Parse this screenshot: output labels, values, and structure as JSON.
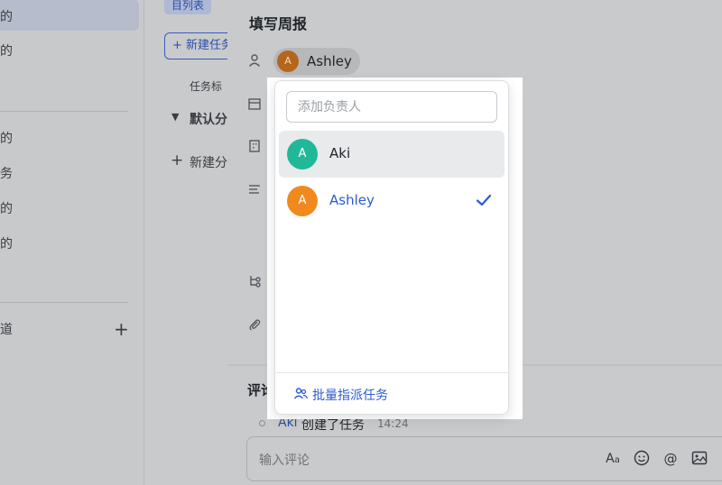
{
  "sidebar": {
    "items": [
      "的",
      "的",
      "的",
      "务",
      "的",
      "的",
      "道"
    ],
    "add_icon": "plus-icon"
  },
  "list_view": {
    "tab_label": "目列表",
    "new_task_label": "+ 新建任务",
    "task_header": "任务标",
    "default_group": "默认分",
    "new_group": "新建分"
  },
  "task_detail": {
    "title": "填写周报",
    "assignee": {
      "initial": "A",
      "name": "Ashley"
    },
    "comment_label": "评论",
    "activity": {
      "user": "Aki",
      "action": "创建了任务",
      "time": "14:24"
    },
    "comment_placeholder": "输入评论",
    "toolbar_icons": [
      "font-icon",
      "emoji-icon",
      "mention-icon",
      "image-icon"
    ]
  },
  "assignee_popup": {
    "search_placeholder": "添加负责人",
    "options": [
      {
        "initial": "A",
        "name": "Aki",
        "color": "#21b89a",
        "selected": false
      },
      {
        "initial": "A",
        "name": "Ashley",
        "color": "#f08a1f",
        "selected": true
      }
    ],
    "batch_assign_label": "批量指派任务",
    "accent_color": "#2c5bd3"
  }
}
